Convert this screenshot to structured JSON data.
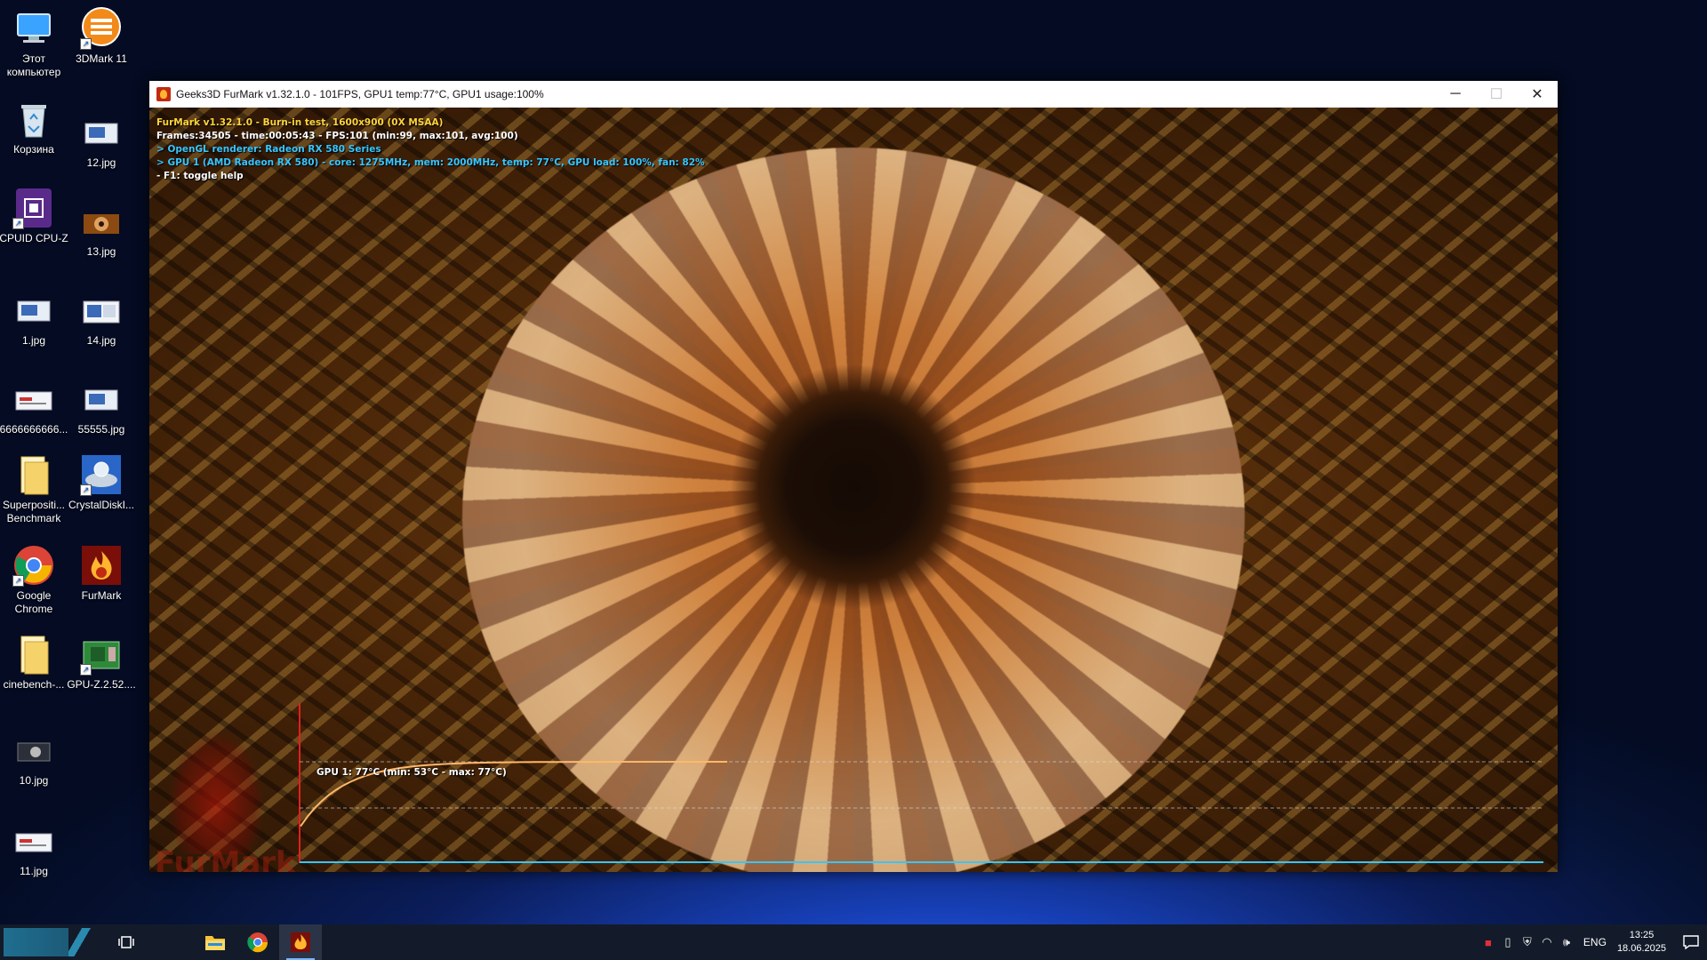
{
  "desktop": {
    "icons": [
      {
        "label": "Этот\nкомпьютер",
        "icon": "monitor-icon"
      },
      {
        "label": "3DMark 11",
        "icon": "3dmark-icon"
      },
      {
        "label": "Корзина",
        "icon": "recycle-bin-icon"
      },
      {
        "label": "12.jpg",
        "icon": "image-file-icon"
      },
      {
        "label": "CPUID CPU-Z",
        "icon": "cpuz-icon"
      },
      {
        "label": "13.jpg",
        "icon": "image-file-icon"
      },
      {
        "label": "1.jpg",
        "icon": "image-file-icon"
      },
      {
        "label": "14.jpg",
        "icon": "image-file-icon"
      },
      {
        "label": "6666666666...",
        "icon": "image-file-icon"
      },
      {
        "label": "55555.jpg",
        "icon": "image-file-icon"
      },
      {
        "label": "Superpositi...\nBenchmark",
        "icon": "folder-icon"
      },
      {
        "label": "CrystalDiskI...",
        "icon": "crystaldisk-icon"
      },
      {
        "label": "Google\nChrome",
        "icon": "chrome-icon"
      },
      {
        "label": "FurMark",
        "icon": "furmark-icon"
      },
      {
        "label": "cinebench-...",
        "icon": "folder-icon"
      },
      {
        "label": "GPU-Z.2.52....",
        "icon": "gpuz-icon"
      },
      {
        "label": "10.jpg",
        "icon": "image-file-icon"
      },
      {
        "label": "11.jpg",
        "icon": "image-file-icon"
      }
    ]
  },
  "window": {
    "title": "Geeks3D FurMark v1.32.1.0 - 101FPS, GPU1 temp:77°C, GPU1 usage:100%",
    "controls": {
      "minimize": "─",
      "maximize": "☐",
      "close": "✕"
    }
  },
  "overlay": {
    "line1": "FurMark v1.32.1.0 - Burn-in test, 1600x900 (0X MSAA)",
    "line2": "Frames:34505 - time:00:05:43 - FPS:101 (min:99, max:101, avg:100)",
    "line3": "> OpenGL renderer: Radeon RX 580 Series",
    "line4": "> GPU 1 (AMD Radeon RX 580) - core: 1275MHz, mem: 2000MHz, temp: 77°C, GPU load: 100%, fan: 82%",
    "line5": "- F1: toggle help"
  },
  "graph": {
    "label": "GPU 1: 77°C (min: 53°C - max: 77°C)",
    "min": 53,
    "max": 77,
    "current": 77,
    "color": "#ffb86a"
  },
  "logo": {
    "text": "FurMark"
  },
  "taskbar": {
    "apps": [
      {
        "name": "task-view",
        "icon": "task-view-icon"
      },
      {
        "name": "file-explorer",
        "icon": "folder-icon"
      },
      {
        "name": "chrome",
        "icon": "chrome-icon"
      },
      {
        "name": "furmark",
        "icon": "furmark-icon",
        "active": true
      }
    ],
    "tray": {
      "language": "ENG",
      "time": "13:25",
      "date": "18.06.2025"
    }
  }
}
